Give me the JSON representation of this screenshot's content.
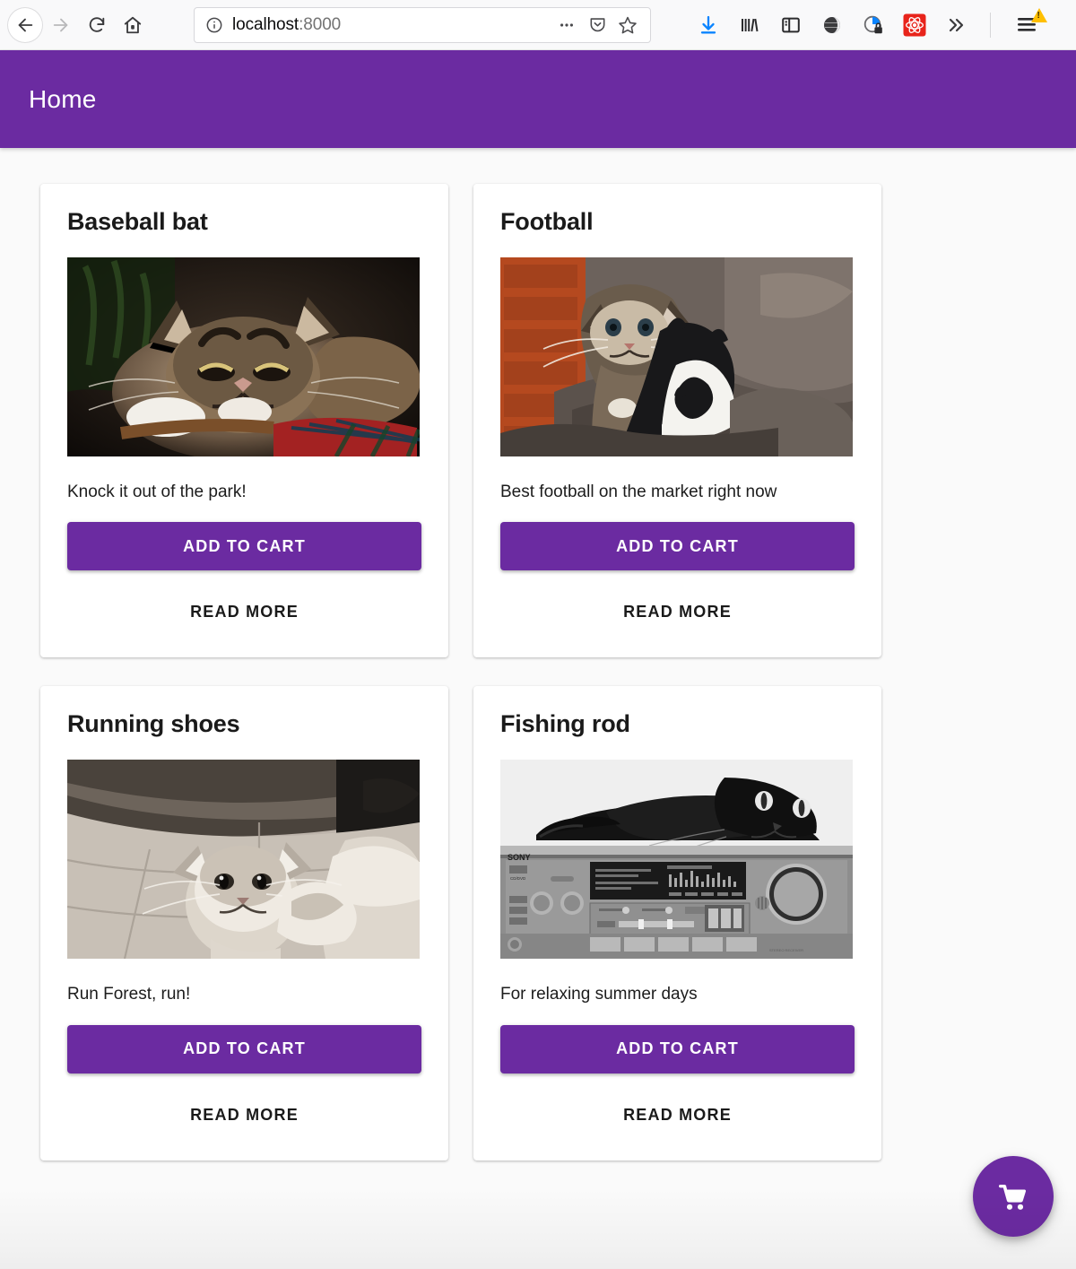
{
  "browser": {
    "nav": {
      "back_label": "Back",
      "forward_label": "Forward",
      "reload_label": "Reload",
      "home_label": "Home"
    },
    "urlbar": {
      "host": "localhost",
      "port": ":8000",
      "identity_icon": "info-circle-icon",
      "page_actions_icon": "ellipsis-icon",
      "pocket_icon": "pocket-shield-icon",
      "bookmark_icon": "star-outline-icon"
    },
    "toolbar_icons": [
      {
        "name": "downloads-icon",
        "label": "Downloads"
      },
      {
        "name": "library-icon",
        "label": "Library"
      },
      {
        "name": "sidebar-icon",
        "label": "Sidebars"
      },
      {
        "name": "globe-dark-icon",
        "label": "Extension"
      },
      {
        "name": "container-lock-icon",
        "label": "Privacy container"
      },
      {
        "name": "react-devtools-icon",
        "label": "React DevTools"
      },
      {
        "name": "overflow-chevrons-icon",
        "label": "More tools"
      }
    ],
    "menu": {
      "name": "app-menu-icon",
      "label": "Open application menu",
      "warning_badge": "!"
    }
  },
  "appbar": {
    "title": "Home",
    "color": "#6b2ba1"
  },
  "theme": {
    "primary": "#6b2ba1",
    "page_bg": "#fafafa",
    "card_bg": "#ffffff",
    "text": "#1a1a1a"
  },
  "products": [
    {
      "title": "Baseball bat",
      "description": "Knock it out of the park!",
      "image_alt": "Tabby cat resting in a basket",
      "add_to_cart_label": "ADD TO CART",
      "read_more_label": "READ MORE"
    },
    {
      "title": "Football",
      "description": "Best football on the market right now",
      "image_alt": "Two kittens among rocks",
      "add_to_cart_label": "ADD TO CART",
      "read_more_label": "READ MORE"
    },
    {
      "title": "Running shoes",
      "description": "Run Forest, run!",
      "image_alt": "Fluffy cat on tiled floor, sepia",
      "add_to_cart_label": "ADD TO CART",
      "read_more_label": "READ MORE"
    },
    {
      "title": "Fishing rod",
      "description": "For relaxing summer days",
      "image_alt": "Black cat lying on a Sony stereo receiver",
      "add_to_cart_label": "ADD TO CART",
      "read_more_label": "READ MORE"
    }
  ],
  "fab": {
    "icon": "shopping-cart-icon",
    "label": "View cart"
  }
}
